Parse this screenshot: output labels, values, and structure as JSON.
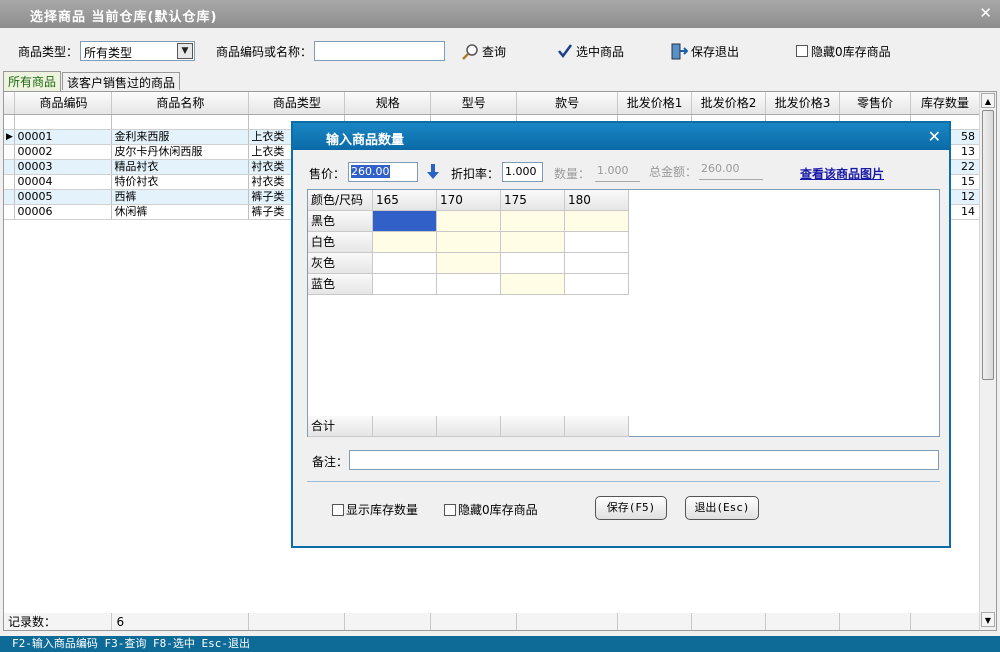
{
  "window": {
    "title": "选择商品  当前仓库(默认仓库)"
  },
  "toolbar": {
    "category_label": "商品类型：",
    "category_value": "所有类型",
    "code_label": "商品编码或名称：",
    "code_value": "",
    "query_label": "查询",
    "select_label": "选中商品",
    "save_exit_label": "保存退出",
    "hide_zero_label": "隐藏0库存商品"
  },
  "tabs": [
    {
      "label": "所有商品"
    },
    {
      "label": "该客户销售过的商品"
    }
  ],
  "grid": {
    "columns": [
      "商品编码",
      "商品名称",
      "商品类型",
      "规格",
      "型号",
      "款号",
      "批发价格1",
      "批发价格2",
      "批发价格3",
      "零售价",
      "库存数量"
    ],
    "rows": [
      {
        "code": "00001",
        "name": "金利来西服",
        "type": "上衣类",
        "stock": "58"
      },
      {
        "code": "00002",
        "name": "皮尔卡丹休闲西服",
        "type": "上衣类",
        "stock": "13"
      },
      {
        "code": "00003",
        "name": "精品衬衣",
        "type": "衬衣类",
        "stock": "22"
      },
      {
        "code": "00004",
        "name": "特价衬衣",
        "type": "衬衣类",
        "stock": "15"
      },
      {
        "code": "00005",
        "name": "西裤",
        "type": "裤子类",
        "stock": "12"
      },
      {
        "code": "00006",
        "name": "休闲裤",
        "type": "裤子类",
        "stock": "14"
      }
    ],
    "footer_label": "记录数：",
    "footer_value": "6"
  },
  "statusbar": {
    "text": "F2-输入商品编码 F3-查询 F8-选中 Esc-退出"
  },
  "dialog": {
    "title": "输入商品数量",
    "price_label": "售价：",
    "price_value": "260.00",
    "discount_label": "折扣率：",
    "discount_value": "1.000",
    "qty_label": "数量：",
    "qty_value": "1.000",
    "total_label": "总金额：",
    "total_value": "260.00",
    "view_image_link": "查看该商品图片",
    "matrix": {
      "corner": "颜色/尺码",
      "sizes": [
        "165",
        "170",
        "175",
        "180"
      ],
      "colors": [
        "黑色",
        "白色",
        "灰色",
        "蓝色"
      ],
      "total_label": "合计"
    },
    "remark_label": "备注：",
    "remark_value": "",
    "show_stock_label": "显示库存数量",
    "hide_zero_label": "隐藏0库存商品",
    "save_button": "保存(F5)",
    "exit_button": "退出(Esc)"
  }
}
